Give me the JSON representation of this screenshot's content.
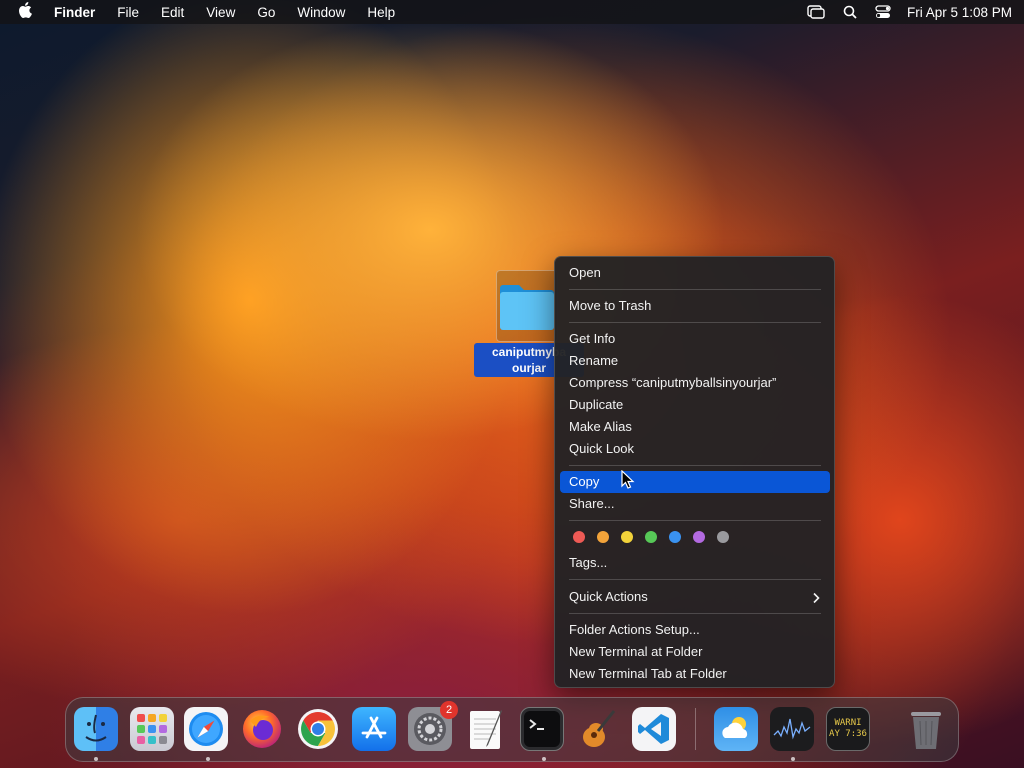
{
  "menubar": {
    "apple_icon": "apple-logo-icon",
    "app_name": "Finder",
    "menus": [
      "File",
      "Edit",
      "View",
      "Go",
      "Window",
      "Help"
    ],
    "status_icons": [
      "screen-mirroring-icon",
      "spotlight-search-icon",
      "control-center-icon"
    ],
    "clock": "Fri Apr 5  1:08 PM"
  },
  "desktop": {
    "folder": {
      "icon": "folder-icon",
      "label": "caniputmyballsinyourjar",
      "label_visible_line1": "caniputmyba",
      "label_visible_line2": "ourjar"
    }
  },
  "context_menu": {
    "items": [
      {
        "label": "Open"
      },
      {
        "label": "Move to Trash"
      },
      {
        "label": "Get Info"
      },
      {
        "label": "Rename"
      },
      {
        "label": "Compress “caniputmyballsinyourjar”"
      },
      {
        "label": "Duplicate"
      },
      {
        "label": "Make Alias"
      },
      {
        "label": "Quick Look"
      },
      {
        "label": "Copy",
        "highlighted": true
      },
      {
        "label": "Share..."
      },
      {
        "label": "Tags..."
      },
      {
        "label": "Quick Actions",
        "submenu": true
      },
      {
        "label": "Folder Actions Setup..."
      },
      {
        "label": "New Terminal at Folder"
      },
      {
        "label": "New Terminal Tab at Folder"
      }
    ],
    "tag_colors": [
      "#ee5a55",
      "#f3a33a",
      "#f2d23a",
      "#57c857",
      "#3a92f0",
      "#b36ae0",
      "#9a9a9e"
    ],
    "highlight_color": "#0a56d6"
  },
  "dock": {
    "apps": [
      {
        "name": "Finder",
        "icon": "finder-icon",
        "running": true
      },
      {
        "name": "Launchpad",
        "icon": "launchpad-icon",
        "running": false
      },
      {
        "name": "Safari",
        "icon": "safari-icon",
        "running": true
      },
      {
        "name": "Firefox",
        "icon": "firefox-icon",
        "running": false
      },
      {
        "name": "Chrome",
        "icon": "chrome-icon",
        "running": false
      },
      {
        "name": "App Store",
        "icon": "app-store-icon",
        "running": false
      },
      {
        "name": "System Settings",
        "icon": "system-settings-icon",
        "running": false,
        "badge": "2"
      },
      {
        "name": "TextEdit",
        "icon": "textedit-icon",
        "running": false
      },
      {
        "name": "Terminal",
        "icon": "terminal-icon",
        "running": true
      },
      {
        "name": "GarageBand",
        "icon": "garageband-icon",
        "running": false
      },
      {
        "name": "Visual Studio Code",
        "icon": "vscode-icon",
        "running": false
      },
      {
        "name": "Weather",
        "icon": "weather-icon",
        "running": false
      },
      {
        "name": "Stocks",
        "icon": "stocks-icon",
        "running": true
      },
      {
        "name": "Console",
        "icon": "console-icon",
        "running": false,
        "text": "WARNI\nAY 7:36"
      },
      {
        "name": "Trash",
        "icon": "trash-icon",
        "running": false
      }
    ]
  }
}
